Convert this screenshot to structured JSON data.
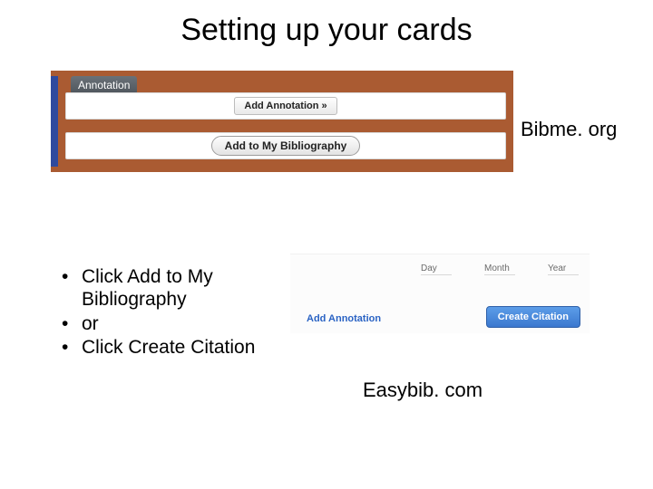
{
  "title": "Setting up your cards",
  "bibme": {
    "tab_label": "Annotation",
    "add_annotation_label": "Add Annotation »",
    "add_bibliography_label": "Add to My Bibliography",
    "site_label": "Bibme. org"
  },
  "bullets": {
    "items": [
      "Click Add to My Bibliography",
      "or",
      "Click Create Citation"
    ]
  },
  "easybib": {
    "fields": {
      "day": "Day",
      "month": "Month",
      "year": "Year"
    },
    "add_annotation_link": "Add Annotation",
    "create_citation_label": "Create Citation",
    "site_label": "Easybib. com"
  }
}
